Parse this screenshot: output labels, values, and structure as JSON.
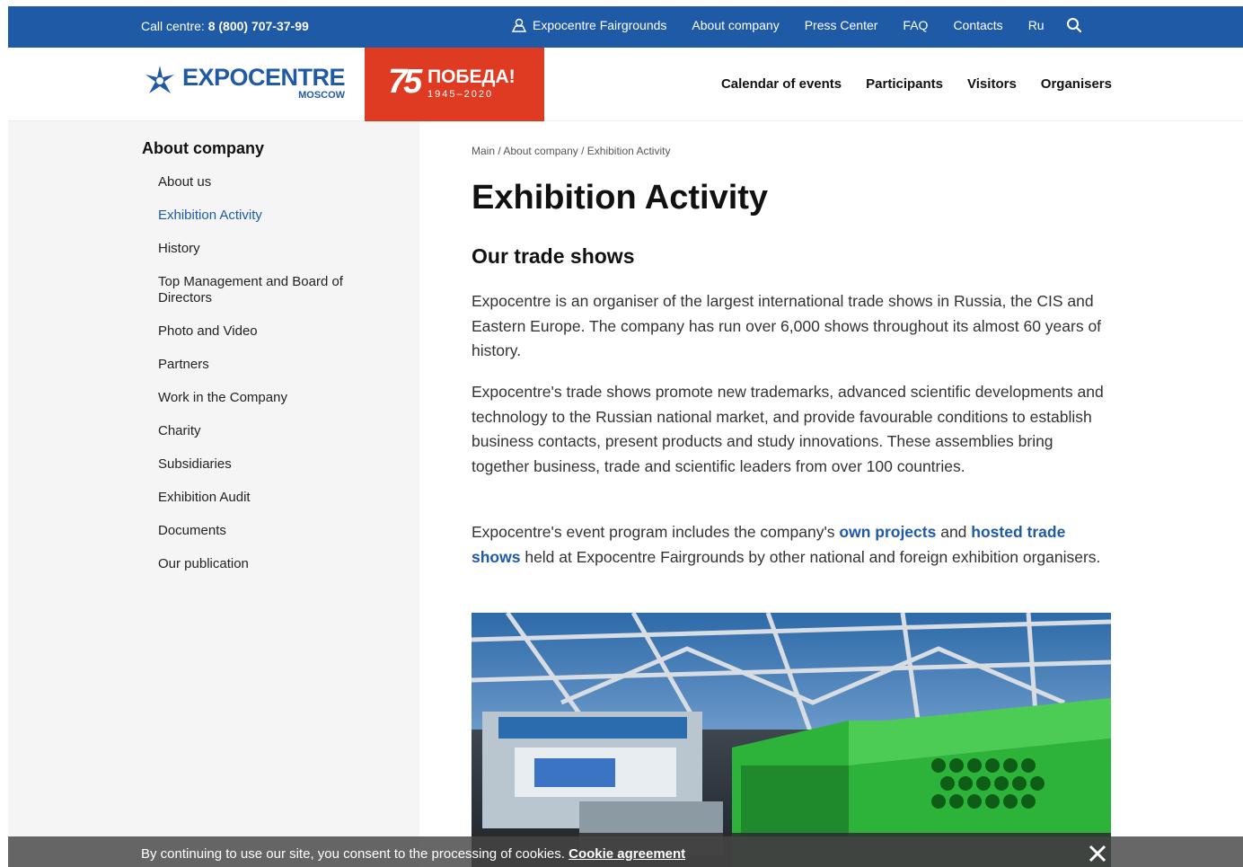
{
  "topbar": {
    "call_label": "Call centre:",
    "call_number": "8 (800) 707-37-99",
    "nav": [
      "Expocentre Fairgrounds",
      "About company",
      "Press Center",
      "FAQ",
      "Contacts",
      "Ru"
    ]
  },
  "header": {
    "logo_main": "EXPOCENTRE",
    "logo_sub": "MOSCOW",
    "victory_num": "75",
    "victory_title": "ПОБЕДА!",
    "victory_years": "1945–2020",
    "mainnav": [
      "Calendar of events",
      "Participants",
      "Visitors",
      "Organisers"
    ]
  },
  "sidebar": {
    "title": "About company",
    "items": [
      {
        "label": "About us"
      },
      {
        "label": "Exhibition Activity",
        "active": true
      },
      {
        "label": "History"
      },
      {
        "label": "Top Management and Board of Directors"
      },
      {
        "label": "Photo and Video"
      },
      {
        "label": "Partners"
      },
      {
        "label": "Work in the Company"
      },
      {
        "label": "Charity"
      },
      {
        "label": "Subsidiaries"
      },
      {
        "label": "Exhibition Audit"
      },
      {
        "label": "Documents"
      },
      {
        "label": "Our publication"
      }
    ]
  },
  "content": {
    "breadcrumb": [
      "Main",
      "About company",
      "Exhibition Activity"
    ],
    "title": "Exhibition Activity",
    "subtitle": "Our trade shows",
    "p1": "Expocentre is an organiser of the largest international trade shows in Russia, the CIS and Eastern Europe. The company has run over 6,000 shows throughout its almost 60 years of history.",
    "p2": "Expocentre's trade shows promote new trademarks, advanced scientific developments and technology to the Russian national market, and provide favourable conditions to establish business contacts, present products and study innovations. These assemblies bring together business, trade and scientific leaders from over 100 countries.",
    "p3_a": "Expocentre's event program includes the company's ",
    "p3_link1": "own projects",
    "p3_b": " and ",
    "p3_link2": "hosted trade shows",
    "p3_c": " held at Expocentre Fairgrounds by other national and foreign exhibition organisers."
  },
  "cookie": {
    "text": "By continuing to use our site, you consent to the processing of cookies. ",
    "link": "Cookie agreement"
  },
  "colors": {
    "brand_blue": "#1f5aa6",
    "victory_red": "#df3a22",
    "sidebar_bg": "#f5f5f5"
  }
}
